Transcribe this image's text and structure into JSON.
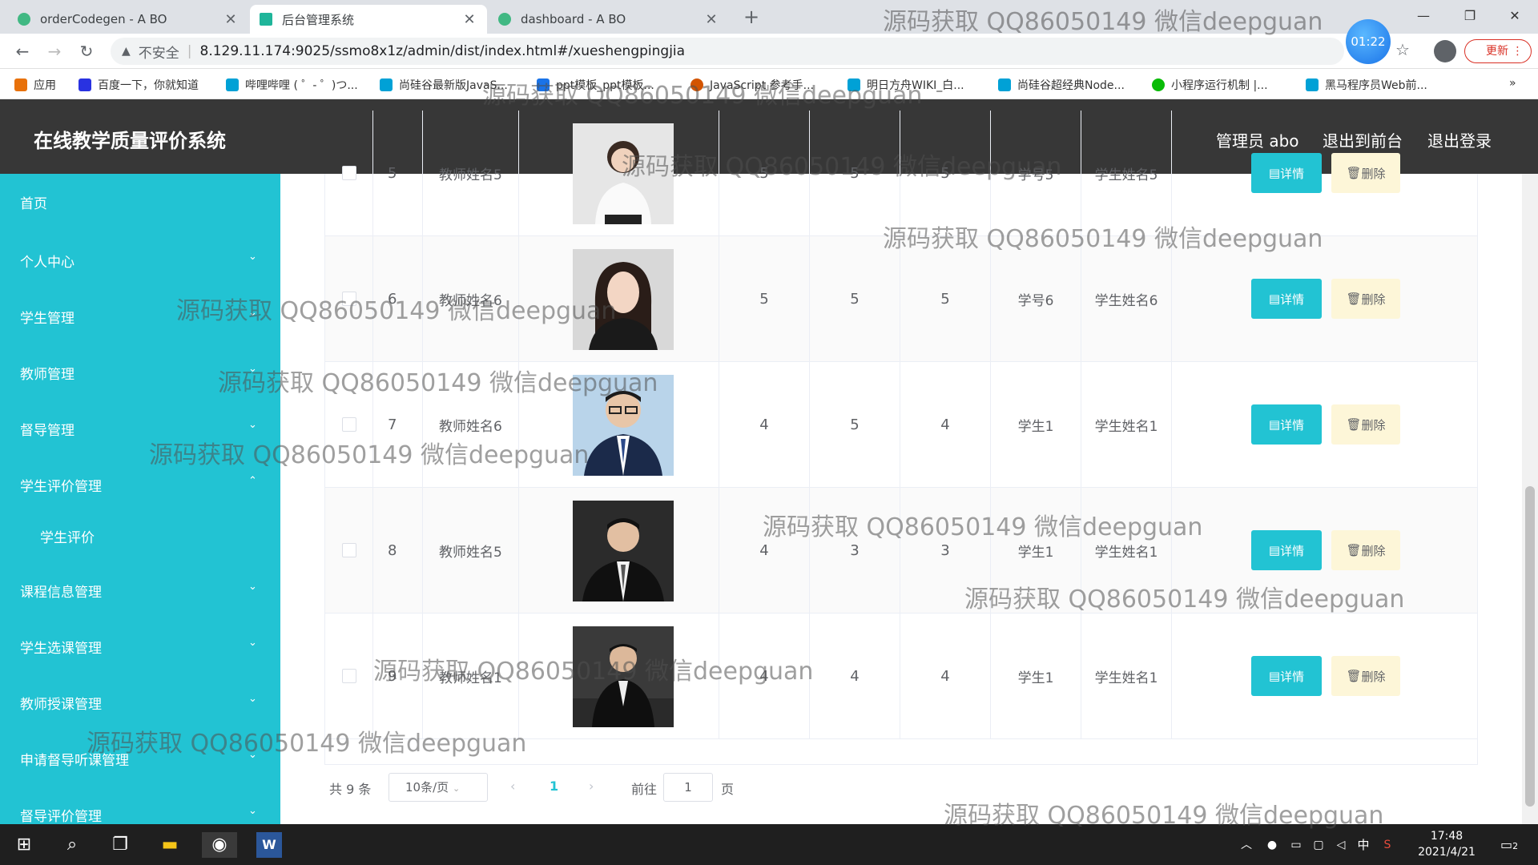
{
  "browser": {
    "tabs": [
      {
        "title": "orderCodegen - A BO",
        "active": false
      },
      {
        "title": "后台管理系统",
        "active": true
      },
      {
        "title": "dashboard - A BO",
        "active": false
      }
    ],
    "address": {
      "security": "不安全",
      "url": "8.129.11.174:9025/ssmo8x1z/admin/dist/index.html#/xueshengpingjia"
    },
    "clock_badge": "01:22",
    "update_label": "更新",
    "bookmarks": [
      "应用",
      "百度一下，你就知道",
      "哔哩哔哩 ( ゜- ゜)つ...",
      "尚硅谷最新版JavaS...",
      "ppt模板_ppt模板...",
      "JavaScript 参考手...",
      "明日方舟WIKI_白...",
      "尚硅谷超经典Node...",
      "小程序运行机制 |...",
      "黑马程序员Web前..."
    ],
    "bookmarks_more": "»"
  },
  "header": {
    "title": "在线教学质量评价系统",
    "admin": "管理员 abo",
    "exit_front": "退出到前台",
    "logout": "退出登录"
  },
  "sidebar": {
    "items": [
      {
        "label": "首页"
      },
      {
        "label": "个人中心",
        "chevron": "⌄"
      },
      {
        "label": "学生管理",
        "chevron": "⌄"
      },
      {
        "label": "教师管理",
        "chevron": "⌄"
      },
      {
        "label": "督导管理",
        "chevron": "⌄"
      },
      {
        "label": "学生评价管理",
        "chevron": "⌃"
      },
      {
        "label": "学生评价",
        "sub": true
      },
      {
        "label": "课程信息管理",
        "chevron": "⌄"
      },
      {
        "label": "学生选课管理",
        "chevron": "⌄"
      },
      {
        "label": "教师授课管理",
        "chevron": "⌄"
      },
      {
        "label": "申请督导听课管理",
        "chevron": "⌄"
      },
      {
        "label": "督导评价管理",
        "chevron": "⌄"
      }
    ]
  },
  "table": {
    "detail_label": "详情",
    "delete_label": "删除",
    "rows": [
      {
        "idx": "5",
        "teacher": "教师姓名5",
        "s1": "5",
        "s2": "5",
        "s3": "5",
        "sid": "学号5",
        "sname": "学生姓名5",
        "photo": "woman-white-shirt"
      },
      {
        "idx": "6",
        "teacher": "教师姓名6",
        "s1": "5",
        "s2": "5",
        "s3": "5",
        "sid": "学号6",
        "sname": "学生姓名6",
        "photo": "woman-portrait"
      },
      {
        "idx": "7",
        "teacher": "教师姓名6",
        "s1": "4",
        "s2": "5",
        "s3": "4",
        "sid": "学生1",
        "sname": "学生姓名1",
        "photo": "man-suit-glasses"
      },
      {
        "idx": "8",
        "teacher": "教师姓名5",
        "s1": "4",
        "s2": "3",
        "s3": "3",
        "sid": "学生1",
        "sname": "学生姓名1",
        "photo": "man-suit-dark"
      },
      {
        "idx": "9",
        "teacher": "教师姓名1",
        "s1": "4",
        "s2": "4",
        "s3": "4",
        "sid": "学生1",
        "sname": "学生姓名1",
        "photo": "man-suit-seated"
      }
    ]
  },
  "pagination": {
    "total": "共 9 条",
    "page_size": "10条/页",
    "current": "1",
    "goto_prefix": "前往",
    "goto_value": "1",
    "goto_suffix": "页"
  },
  "taskbar": {
    "time": "17:48",
    "date": "2021/4/21",
    "ime": "中",
    "notif": "2"
  },
  "watermark": "源码获取 QQ86050149 微信deepguan",
  "colors": {
    "sidebar": "#22c3d3",
    "header": "#373737",
    "detail_btn": "#22c3d3",
    "delete_btn": "#fdf6d8"
  }
}
